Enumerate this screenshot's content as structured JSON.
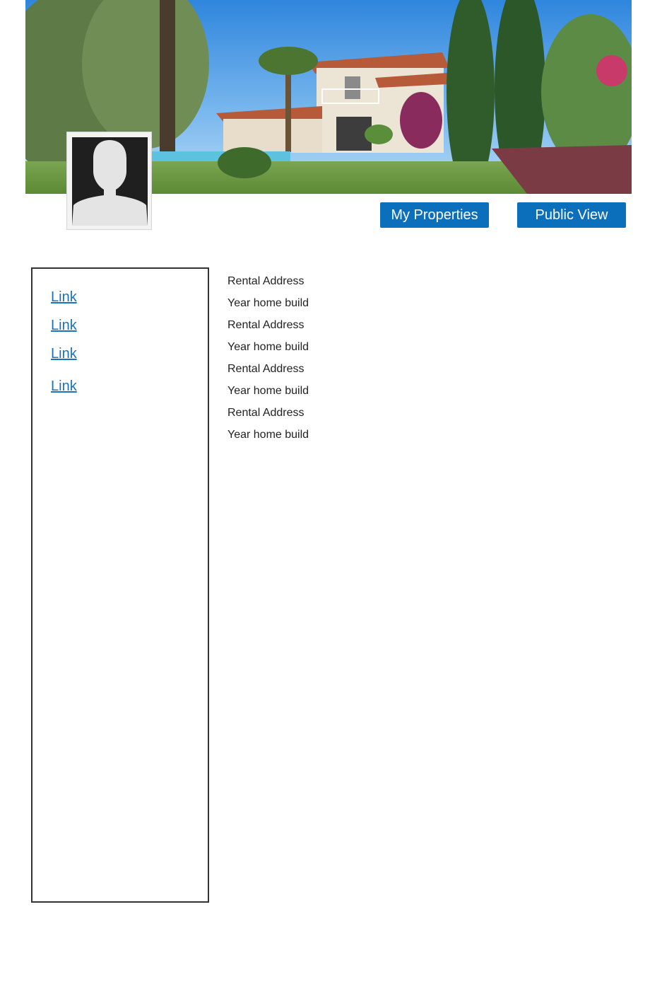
{
  "header": {
    "buttons": {
      "my_properties": "My Properties",
      "public_view": "Public View"
    },
    "accent_color": "#0b6fbc"
  },
  "sidebar": {
    "links": [
      {
        "label": "Link"
      },
      {
        "label": "Link"
      },
      {
        "label": "Link"
      },
      {
        "label": "Link"
      }
    ],
    "link_color": "#1a73b8"
  },
  "main": {
    "fields": [
      {
        "label": "Rental Address"
      },
      {
        "label": "Year home build"
      },
      {
        "label": "Rental Address"
      },
      {
        "label": "Year home build"
      },
      {
        "label": "Rental Address"
      },
      {
        "label": "Year home build"
      },
      {
        "label": "Rental Address"
      },
      {
        "label": "Year home build"
      }
    ]
  },
  "icons": {
    "avatar": "user-silhouette-icon"
  }
}
